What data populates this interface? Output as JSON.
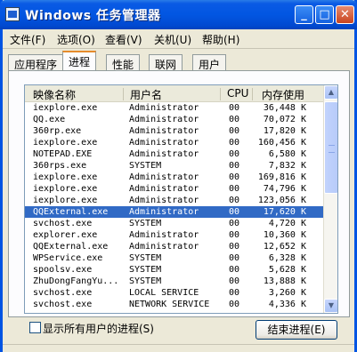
{
  "window": {
    "title": "Windows 任务管理器"
  },
  "titlebar_buttons": {
    "minimize": "_",
    "maximize": "□",
    "close": "✕"
  },
  "menu": [
    "文件(F)",
    "选项(O)",
    "查看(V)",
    "关机(U)",
    "帮助(H)"
  ],
  "tabs": [
    {
      "label": "应用程序",
      "active": false
    },
    {
      "label": "进程",
      "active": true
    },
    {
      "label": "性能",
      "active": false
    },
    {
      "label": "联网",
      "active": false
    },
    {
      "label": "用户",
      "active": false
    }
  ],
  "table": {
    "columns": [
      "映像名称",
      "用户名",
      "CPU",
      "内存使用"
    ],
    "rows": [
      {
        "name": "iexplore.exe",
        "user": "Administrator",
        "cpu": "00",
        "mem": "36,448 K"
      },
      {
        "name": "QQ.exe",
        "user": "Administrator",
        "cpu": "00",
        "mem": "70,072 K"
      },
      {
        "name": "360rp.exe",
        "user": "Administrator",
        "cpu": "00",
        "mem": "17,820 K"
      },
      {
        "name": "iexplore.exe",
        "user": "Administrator",
        "cpu": "00",
        "mem": "160,456 K"
      },
      {
        "name": "NOTEPAD.EXE",
        "user": "Administrator",
        "cpu": "00",
        "mem": "6,580 K"
      },
      {
        "name": "360rps.exe",
        "user": "SYSTEM",
        "cpu": "00",
        "mem": "7,832 K"
      },
      {
        "name": "iexplore.exe",
        "user": "Administrator",
        "cpu": "00",
        "mem": "169,816 K"
      },
      {
        "name": "iexplore.exe",
        "user": "Administrator",
        "cpu": "00",
        "mem": "74,796 K"
      },
      {
        "name": "iexplore.exe",
        "user": "Administrator",
        "cpu": "00",
        "mem": "123,056 K"
      },
      {
        "name": "QQExternal.exe",
        "user": "Administrator",
        "cpu": "00",
        "mem": "17,620 K",
        "selected": true
      },
      {
        "name": "svchost.exe",
        "user": "SYSTEM",
        "cpu": "00",
        "mem": "4,720 K"
      },
      {
        "name": "explorer.exe",
        "user": "Administrator",
        "cpu": "00",
        "mem": "10,360 K"
      },
      {
        "name": "QQExternal.exe",
        "user": "Administrator",
        "cpu": "00",
        "mem": "12,652 K"
      },
      {
        "name": "WPService.exe",
        "user": "SYSTEM",
        "cpu": "00",
        "mem": "6,328 K"
      },
      {
        "name": "spoolsv.exe",
        "user": "SYSTEM",
        "cpu": "00",
        "mem": "5,628 K"
      },
      {
        "name": "ZhuDongFangYu...",
        "user": "SYSTEM",
        "cpu": "00",
        "mem": "13,888 K"
      },
      {
        "name": "svchost.exe",
        "user": "LOCAL SERVICE",
        "cpu": "00",
        "mem": "3,260 K"
      },
      {
        "name": "svchost.exe",
        "user": "NETWORK SERVICE",
        "cpu": "00",
        "mem": "4,336 K"
      }
    ]
  },
  "footer": {
    "show_all_label": "显示所有用户的进程(S)",
    "show_all_checked": false,
    "end_process_label": "结束进程(E)"
  }
}
